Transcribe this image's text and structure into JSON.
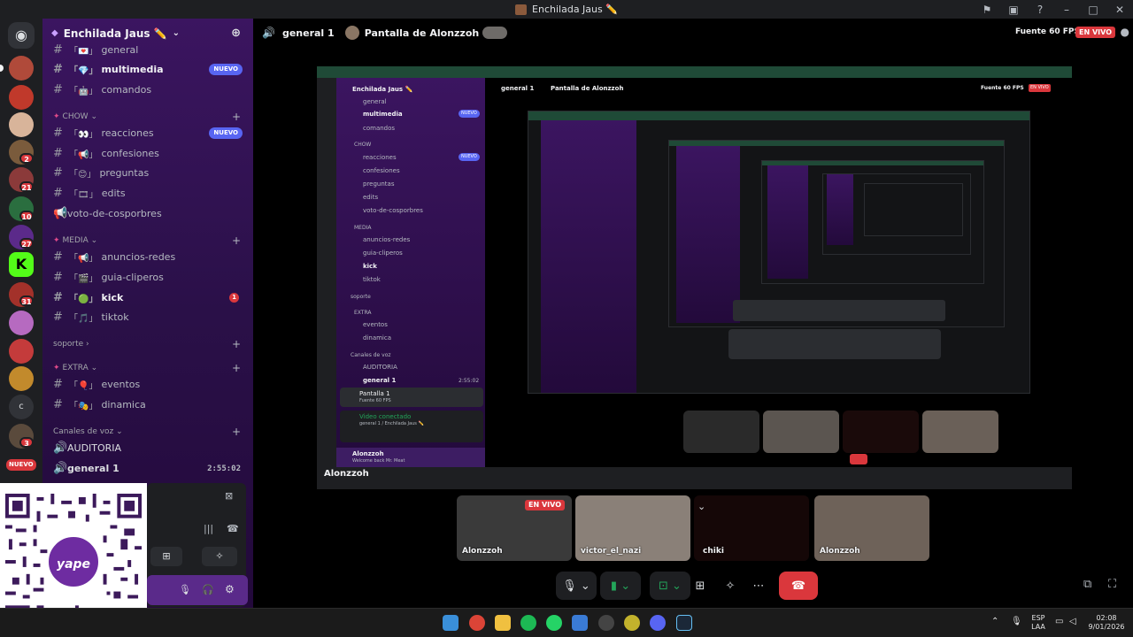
{
  "window": {
    "title": "Enchilada Jaus ✏️"
  },
  "titlebar_icons": [
    "flag-icon",
    "inbox-icon",
    "help-icon",
    "minimize-icon",
    "maximize-icon",
    "close-icon"
  ],
  "server": {
    "name": "Enchilada Jaus ✏️",
    "boost_icon": "boost-icon"
  },
  "channels": [
    {
      "name": "general",
      "emoji": "「💌」",
      "bold": false
    },
    {
      "name": "multimedia",
      "emoji": "「💎」",
      "bold": true,
      "badge": "NUEVO"
    },
    {
      "name": "comandos",
      "emoji": "「🤖」",
      "bold": false
    },
    {
      "category": "CHOW"
    },
    {
      "name": "reacciones",
      "emoji": "「👀」",
      "bold": false,
      "badge": "NUEVO"
    },
    {
      "name": "confesiones",
      "emoji": "「📢」",
      "bold": false
    },
    {
      "name": "preguntas",
      "emoji": "「😊」",
      "bold": false
    },
    {
      "name": "edits",
      "emoji": "「🎞」",
      "bold": false
    },
    {
      "name": "voto-de-cosporbres",
      "emoji": "📢",
      "bold": false
    },
    {
      "category": "MEDIA"
    },
    {
      "name": "anuncios-redes",
      "emoji": "「📢」",
      "bold": false
    },
    {
      "name": "guia-cliperos",
      "emoji": "「🎬」",
      "bold": false
    },
    {
      "name": "kick",
      "emoji": "「🟢」",
      "bold": true,
      "unread": "1"
    },
    {
      "name": "tiktok",
      "emoji": "「🎵」",
      "bold": false
    },
    {
      "category": "soporte"
    },
    {
      "category": "EXTRA"
    },
    {
      "name": "eventos",
      "emoji": "「🎈」",
      "bold": false
    },
    {
      "name": "dinamica",
      "emoji": "「🎭」",
      "bold": false
    },
    {
      "category": "Canales de voz"
    },
    {
      "name": "AUDITORIA",
      "voice": true
    },
    {
      "name": "general 1",
      "voice": true,
      "timer": "2:55:02"
    }
  ],
  "rail_badges": [
    "2",
    "21",
    "10",
    "27",
    "31",
    "3"
  ],
  "rail_nuevo": "NUEVO",
  "stage": {
    "channel": "general 1",
    "share_title": "Pantalla de Alonzzoh",
    "fps": "Fuente 60 FPS",
    "live": "EN VIVO"
  },
  "share": {
    "inner_server": "Enchilada Jaus ✏️",
    "inner_channel": "general 1",
    "inner_share": "Pantalla de Alonzzoh",
    "inner_fps": "Fuente 60 FPS",
    "inner_live": "EN VIVO",
    "inner_channels": [
      "general",
      "multimedia",
      "comandos",
      "CHOW",
      "reacciones",
      "confesiones",
      "preguntas",
      "edits",
      "voto-de-cosporbres",
      "MEDIA",
      "anuncios-redes",
      "guia-cliperos",
      "kick",
      "tiktok",
      "soporte",
      "EXTRA",
      "eventos",
      "dinamica",
      "Canales de voz",
      "AUDITORIA",
      "general 1"
    ],
    "inner_timer": "2:55:02",
    "inner_nuevo": "NUEVO",
    "inner_screen": "Pantalla 1",
    "inner_screen_sub": "Fuente 60 FPS",
    "voice_status": "Video conectado",
    "voice_sub": "general 1 / Enchilada Jaus ✏️",
    "inner_user": "Alonzzoh",
    "inner_user_status": "Welcome back Mr. Meat",
    "presenter": "Alonzzoh"
  },
  "tiles": [
    {
      "name": "Alonzzoh",
      "live": "EN VIVO"
    },
    {
      "name": "victor_el_nazi"
    },
    {
      "name": "chiki"
    },
    {
      "name": "Alonzzoh"
    }
  ],
  "qr": {
    "brand": "yape"
  },
  "taskbar": {
    "lang1": "ESP",
    "lang2": "LAA",
    "time": "02:08",
    "date": "9/01/2026"
  }
}
